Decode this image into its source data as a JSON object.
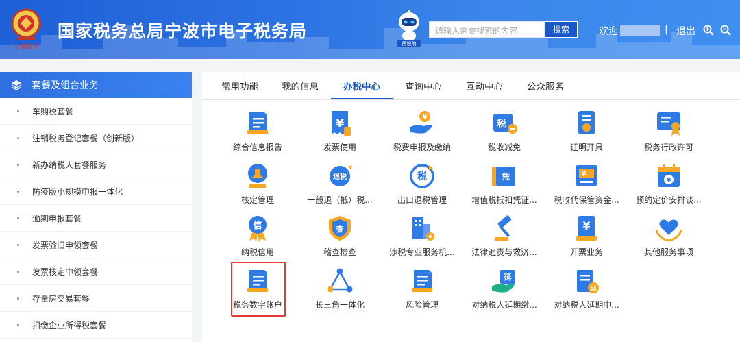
{
  "header": {
    "site_title": "国家税务总局宁波市电子税务局",
    "emblem_caption": "中国税务",
    "robot_caption": "甬税助",
    "search_placeholder": "请输入需要搜索的内容",
    "search_label": "搜索",
    "welcome": "欢迎",
    "separator": "|",
    "logout": "退出"
  },
  "sidebar": {
    "title": "套餐及组合业务",
    "items": [
      "车购税套餐",
      "注销税务登记套餐（创新版）",
      "新办纳税人套餐服务",
      "防疫版小规模申报一体化",
      "逾期申报套餐",
      "发票验旧申领套餐",
      "发票核定申领套餐",
      "存量房交易套餐",
      "扣缴企业所得税套餐"
    ]
  },
  "tabs": [
    "常用功能",
    "我的信息",
    "办税中心",
    "查询中心",
    "互动中心",
    "公众服务"
  ],
  "active_tab": "办税中心",
  "icon_text": {
    "tax": "税",
    "yuan": "¥",
    "refund": "退税",
    "voucher": "凭",
    "credit": "信",
    "inspect": "查",
    "delay": "延"
  },
  "functions": [
    [
      "综合信息报告",
      "发票使用",
      "税费申报及缴纳",
      "税收减免",
      "证明开具",
      "税务行政许可"
    ],
    [
      "核定管理",
      "一般退（抵）税...",
      "出口退税管理",
      "增值税抵扣凭证...",
      "税收代保管资金...",
      "预约定价安排谈..."
    ],
    [
      "纳税信用",
      "稽查检查",
      "涉税专业服务机...",
      "法律追责与救济...",
      "开票业务",
      "其他服务事项"
    ],
    [
      "税务数字账户",
      "长三角一体化",
      "风险管理",
      "对纳税人延期缴...",
      "对纳税人延期申..."
    ]
  ],
  "colors": {
    "header_blue": "#2d73e3",
    "accent_blue": "#1a57c7",
    "icon_blue": "#2f7be6",
    "icon_orange": "#f5a623",
    "highlight_red": "#e53935"
  }
}
